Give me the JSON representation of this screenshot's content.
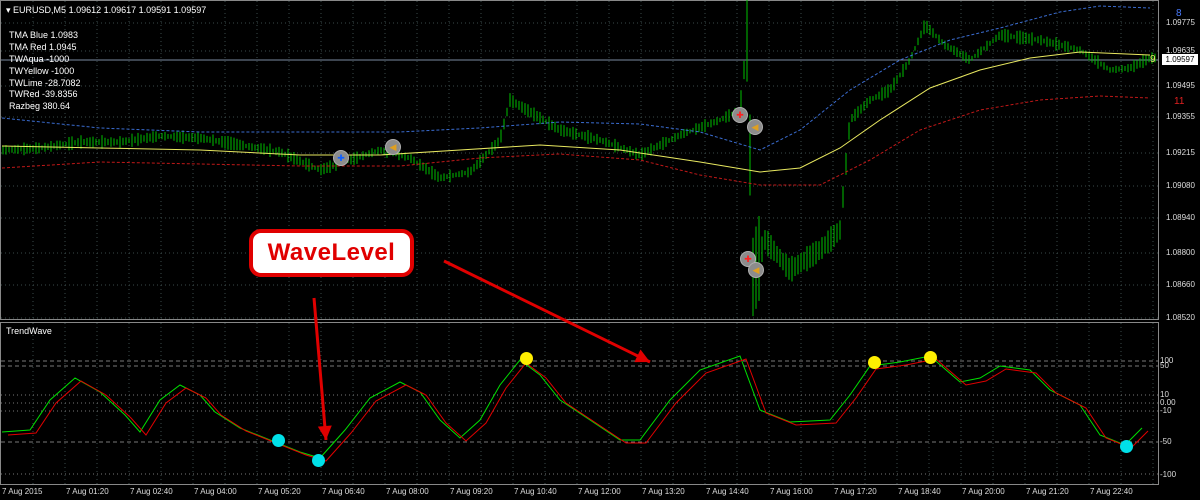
{
  "header": {
    "symbol": "EURUSD,M5",
    "ohlc": "1.09612 1.09617 1.09591 1.09597"
  },
  "indicators": [
    "TMA Blue 1.0983",
    "TMA Red 1.0945",
    "TWAqua -1000",
    "TWYellow -1000",
    "TWLime -28.7082",
    "TWRed -39.8356",
    "Razbeg 380.64"
  ],
  "price_axis": [
    "1.09775",
    "1.09635",
    "1.09495",
    "1.09355",
    "1.09215",
    "1.09080",
    "1.08940",
    "1.08800",
    "1.08660",
    "1.08520"
  ],
  "current_price": "1.09597",
  "corner_labels": {
    "blue": "8",
    "red": "11",
    "yellow": "9"
  },
  "subwindow": {
    "title": "TrendWave",
    "levels": [
      "100",
      "50",
      "10",
      "0.00",
      "-10",
      "-50",
      "-100"
    ]
  },
  "time_axis": [
    "7 Aug 2015",
    "7 Aug 01:20",
    "7 Aug 02:40",
    "7 Aug 04:00",
    "7 Aug 05:20",
    "7 Aug 06:40",
    "7 Aug 08:00",
    "7 Aug 09:20",
    "7 Aug 10:40",
    "7 Aug 12:00",
    "7 Aug 13:20",
    "7 Aug 14:40",
    "7 Aug 16:00",
    "7 Aug 17:20",
    "7 Aug 18:40",
    "7 Aug 20:00",
    "7 Aug 21:20",
    "7 Aug 22:40"
  ],
  "annotation": {
    "label": "WaveLevel"
  },
  "signal_icons": [
    {
      "name": "signal-buy-icon",
      "glyph": "✚",
      "color": "#1060ff"
    },
    {
      "name": "signal-arrow-icon",
      "glyph": "◀",
      "color": "#e0a020"
    },
    {
      "name": "signal-sell-icon",
      "glyph": "✚",
      "color": "#ff2020"
    },
    {
      "name": "signal-arrow-icon",
      "glyph": "◀",
      "color": "#e0a020"
    },
    {
      "name": "signal-sell-icon",
      "glyph": "✚",
      "color": "#ff2020"
    },
    {
      "name": "signal-arrow-icon",
      "glyph": "◀",
      "color": "#e0a020"
    }
  ],
  "colors": {
    "background": "#000000",
    "grid": "#3a4a4a",
    "candles": "#00c000",
    "tma_blue": "#3a6cd0",
    "tma_red": "#c01818",
    "tma_yellow": "#e8e860",
    "osc_lime": "#00e000",
    "osc_red": "#e00000",
    "aqua_dot": "#00e0e8",
    "yellow_dot": "#ffee00",
    "annotation": "#e00000"
  }
}
